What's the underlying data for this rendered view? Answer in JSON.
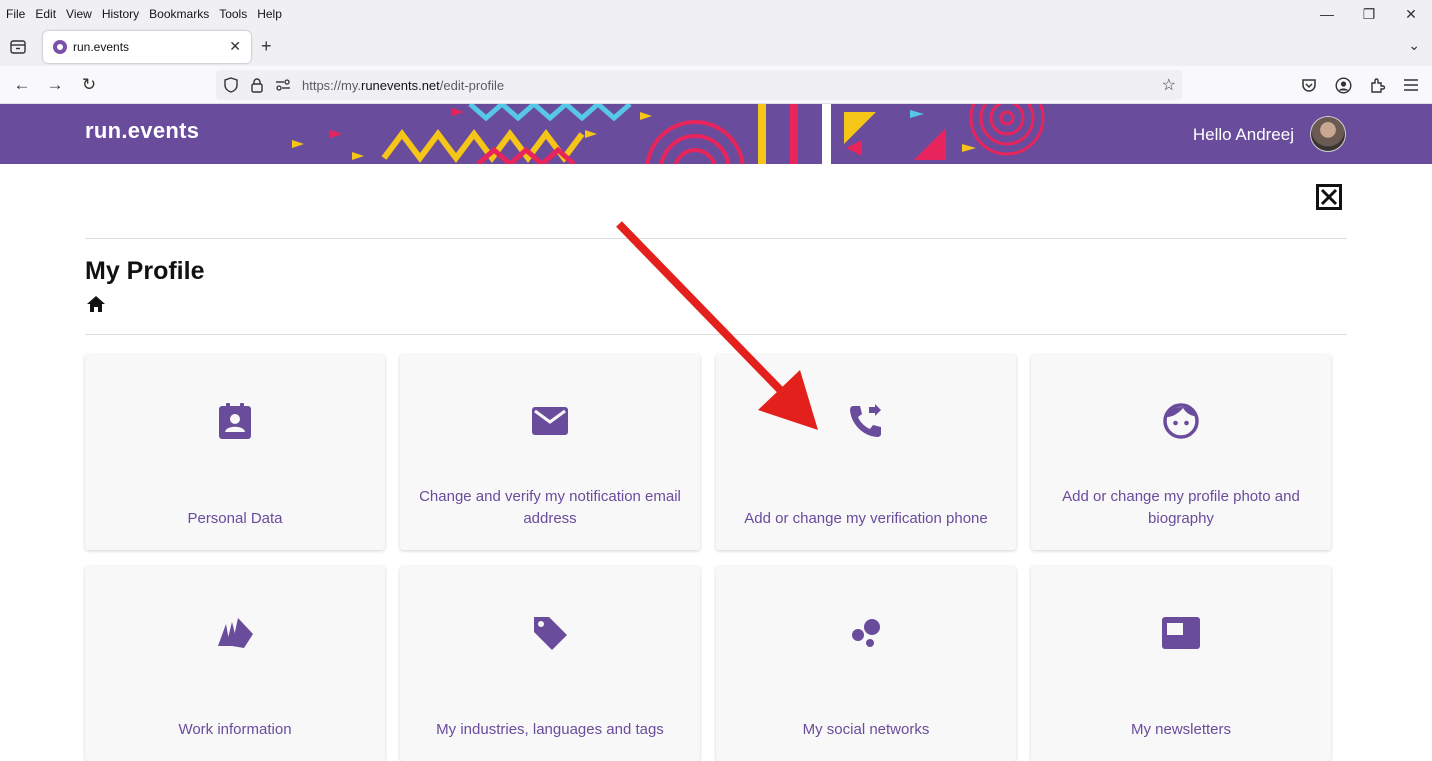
{
  "browser": {
    "menu": [
      "File",
      "Edit",
      "View",
      "History",
      "Bookmarks",
      "Tools",
      "Help"
    ],
    "window_controls": {
      "minimize": "—",
      "restore": "❐",
      "close": "✕"
    },
    "tab": {
      "title": "run.events",
      "close": "✕"
    },
    "new_tab": "+",
    "tab_overflow": "⌄",
    "nav": {
      "back": "←",
      "forward": "→",
      "reload": "↻"
    },
    "url": {
      "prefix": "https://my.",
      "domain": "runevents.net",
      "path": "/edit-profile"
    },
    "bookmark_star": "☆"
  },
  "header": {
    "brand": "run.events",
    "greeting": "Hello Andreej",
    "colors": {
      "brand_purple": "#6a4c9c"
    }
  },
  "page": {
    "close_label": "✕",
    "title": "My Profile"
  },
  "cards": [
    {
      "label": "Personal Data",
      "icon": "contact-calendar-icon"
    },
    {
      "label": "Change and verify my notification email address",
      "icon": "mail-icon"
    },
    {
      "label": "Add or change my verification phone",
      "icon": "phone-forwarded-icon"
    },
    {
      "label": "Add or change my profile photo and biography",
      "icon": "face-icon"
    },
    {
      "label": "Work information",
      "icon": "swatches-icon"
    },
    {
      "label": "My industries, languages and tags",
      "icon": "tag-icon"
    },
    {
      "label": "My social networks",
      "icon": "bubbles-icon"
    },
    {
      "label": "My newsletters",
      "icon": "newsletter-icon"
    }
  ],
  "annotation": {
    "arrow_color": "#e3201b"
  }
}
